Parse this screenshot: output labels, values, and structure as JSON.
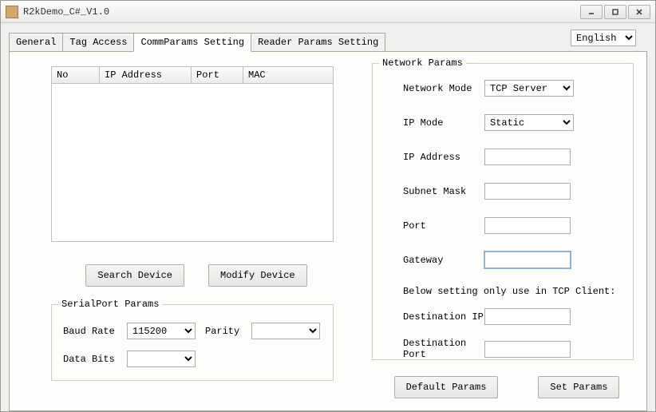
{
  "window": {
    "title": "R2kDemo_C#_V1.0"
  },
  "language": {
    "value": "English",
    "optionEnglish": "English"
  },
  "tabs": {
    "general": "General",
    "tag_access": "Tag Access",
    "comm_params": "CommParams Setting",
    "reader_params": "Reader Params Setting"
  },
  "grid": {
    "headers": {
      "no": "No",
      "ip_address": "IP Address",
      "port": "Port",
      "mac": "MAC"
    }
  },
  "buttons": {
    "search_device": "Search Device",
    "modify_device": "Modify Device",
    "default_params": "Default Params",
    "set_params": "Set Params"
  },
  "serial": {
    "legend": "SerialPort Params",
    "baud_rate_label": "Baud Rate",
    "baud_rate_value": "115200",
    "parity_label": "Parity",
    "parity_value": "",
    "data_bits_label": "Data Bits",
    "data_bits_value": ""
  },
  "network": {
    "legend": "Network Params",
    "network_mode_label": "Network Mode",
    "network_mode_value": "TCP Server",
    "ip_mode_label": "IP Mode",
    "ip_mode_value": "Static",
    "ip_address_label": "IP Address",
    "ip_address_value": "",
    "subnet_mask_label": "Subnet Mask",
    "subnet_mask_value": "",
    "port_label": "Port",
    "port_value": "",
    "gateway_label": "Gateway",
    "gateway_value": "",
    "below_note": "Below setting only use in TCP Client:",
    "dest_ip_label": "Destination IP",
    "dest_ip_value": "",
    "dest_port_label": "Destination Port",
    "dest_port_value": ""
  }
}
